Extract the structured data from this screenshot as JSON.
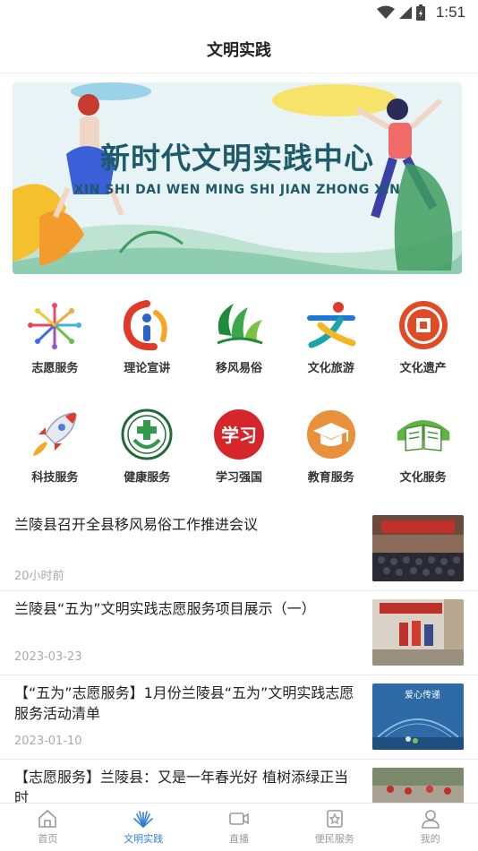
{
  "status_bar": {
    "time": "1:51"
  },
  "header": {
    "title": "文明实践"
  },
  "banner": {
    "title": "新时代文明实践中心",
    "subtitle": "XIN SHI DAI WEN MING SHI JIAN ZHONG XIN"
  },
  "services": [
    {
      "label": "志愿服务",
      "icon": "volunteer-icon"
    },
    {
      "label": "理论宣讲",
      "icon": "theory-icon"
    },
    {
      "label": "移风易俗",
      "icon": "customs-icon"
    },
    {
      "label": "文化旅游",
      "icon": "tourism-icon"
    },
    {
      "label": "文化遗产",
      "icon": "heritage-icon"
    },
    {
      "label": "科技服务",
      "icon": "rocket-icon"
    },
    {
      "label": "健康服务",
      "icon": "health-icon"
    },
    {
      "label": "学习强国",
      "icon": "xuexi-icon"
    },
    {
      "label": "教育服务",
      "icon": "graduation-cap-icon"
    },
    {
      "label": "文化服务",
      "icon": "book-icon"
    }
  ],
  "news": [
    {
      "title": "兰陵县召开全县移风易俗工作推进会议",
      "time": "20小时前"
    },
    {
      "title": "兰陵县“五为”文明实践志愿服务项目展示（一）",
      "time": "2023-03-23"
    },
    {
      "title": "【“五为”志愿服务】1月份兰陵县“五为”文明实践志愿服务活动清单",
      "time": "2023-01-10"
    },
    {
      "title": "【志愿服务】兰陵县：又是一年春光好 植树添绿正当时",
      "time": ""
    }
  ],
  "thumb_text": {
    "news3": "爱心传递"
  },
  "tabbar": [
    {
      "label": "首页",
      "icon": "home-icon"
    },
    {
      "label": "文明实践",
      "icon": "civilization-icon"
    },
    {
      "label": "直播",
      "icon": "video-icon"
    },
    {
      "label": "便民服务",
      "icon": "star-badge-icon"
    },
    {
      "label": "我的",
      "icon": "user-icon"
    }
  ],
  "colors": {
    "accent": "#2f7fd8",
    "inactive": "#999999"
  }
}
